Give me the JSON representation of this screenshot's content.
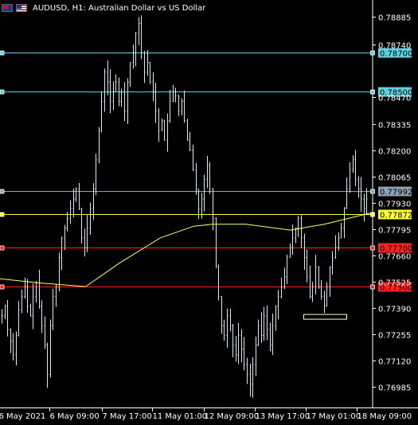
{
  "title": {
    "symbol": "AUDUSD",
    "timeframe": "H1",
    "description": "Australian Dollar vs US Dollar",
    "text": "AUDUSD, H1:  Australian Dollar vs US Dollar",
    "icons": [
      "australia-flag-icon",
      "us-flag-icon"
    ]
  },
  "chart_data": {
    "type": "candlestick",
    "background": "#000000",
    "axis_color": "#ffffff",
    "candle_color": "#d6eaf5",
    "ylim": [
      0.7688,
      0.7897
    ],
    "y_ticks": [
      "0.78885",
      "0.78740",
      "0.78470",
      "0.78335",
      "0.78200",
      "0.78065",
      "0.77930",
      "0.77795",
      "0.77660",
      "0.77525",
      "0.77390",
      "0.77255",
      "0.77120",
      "0.76985"
    ],
    "x_labels": [
      "6 May 2021",
      "6 May 09:00",
      "7 May 17:00",
      "11 May 01:00",
      "12 May 09:00",
      "13 May 17:00",
      "17 May 01:00",
      "18 May 09:00"
    ],
    "horizontal_lines": [
      {
        "name": "resistance-1",
        "price": 0.787,
        "label": "0.78700",
        "color": "#5fd3e0"
      },
      {
        "name": "resistance-2",
        "price": 0.785,
        "label": "0.78500",
        "color": "#5fd3e0"
      },
      {
        "name": "bid",
        "price": 0.77992,
        "label": "0.77992",
        "color": "#8fa3b5"
      },
      {
        "name": "yellow-level",
        "price": 0.77872,
        "label": "0.77872",
        "color": "#ffff33"
      },
      {
        "name": "support-1",
        "price": 0.777,
        "label": "0.77700",
        "color": "#ff2020"
      },
      {
        "name": "support-2",
        "price": 0.775,
        "label": "0.77500",
        "color": "#ff2020"
      }
    ],
    "closes": [
      0.7735,
      0.774,
      0.7728,
      0.7722,
      0.7715,
      0.7725,
      0.7738,
      0.7745,
      0.775,
      0.774,
      0.7735,
      0.7745,
      0.7752,
      0.774,
      0.773,
      0.772,
      0.7705,
      0.773,
      0.7745,
      0.775,
      0.7765,
      0.7775,
      0.778,
      0.7785,
      0.779,
      0.7795,
      0.78,
      0.779,
      0.7775,
      0.777,
      0.778,
      0.779,
      0.78,
      0.7815,
      0.783,
      0.7845,
      0.786,
      0.7855,
      0.7845,
      0.785,
      0.7855,
      0.7845,
      0.785,
      0.784,
      0.7855,
      0.7865,
      0.787,
      0.788,
      0.7885,
      0.787,
      0.786,
      0.7865,
      0.7855,
      0.785,
      0.784,
      0.783,
      0.7835,
      0.7825,
      0.7835,
      0.7845,
      0.785,
      0.7848,
      0.784,
      0.7845,
      0.7835,
      0.7825,
      0.782,
      0.781,
      0.78,
      0.779,
      0.7795,
      0.7805,
      0.7812,
      0.78,
      0.7785,
      0.776,
      0.7745,
      0.773,
      0.7725,
      0.7735,
      0.773,
      0.772,
      0.7715,
      0.7725,
      0.7718,
      0.771,
      0.7705,
      0.77,
      0.771,
      0.772,
      0.773,
      0.7725,
      0.7735,
      0.7728,
      0.772,
      0.773,
      0.774,
      0.7745,
      0.775,
      0.7755,
      0.7765,
      0.777,
      0.7775,
      0.778,
      0.7785,
      0.7775,
      0.7765,
      0.7755,
      0.7745,
      0.775,
      0.776,
      0.775,
      0.7745,
      0.774,
      0.775,
      0.776,
      0.7765,
      0.777,
      0.7775,
      0.778,
      0.779,
      0.78,
      0.781,
      0.7815,
      0.7805,
      0.78,
      0.7795,
      0.779,
      0.7795
    ],
    "moving_average": {
      "color": "#ffff66",
      "points": [
        [
          0,
          0.7754
        ],
        [
          0.1,
          0.7752
        ],
        [
          0.23,
          0.775
        ],
        [
          0.32,
          0.7762
        ],
        [
          0.43,
          0.7775
        ],
        [
          0.52,
          0.7781
        ],
        [
          0.57,
          0.7782
        ],
        [
          0.66,
          0.7782
        ],
        [
          0.78,
          0.7779
        ],
        [
          0.87,
          0.7782
        ],
        [
          1.0,
          0.7788
        ]
      ]
    },
    "annotation_box": {
      "price": 0.77345,
      "label": ""
    }
  }
}
